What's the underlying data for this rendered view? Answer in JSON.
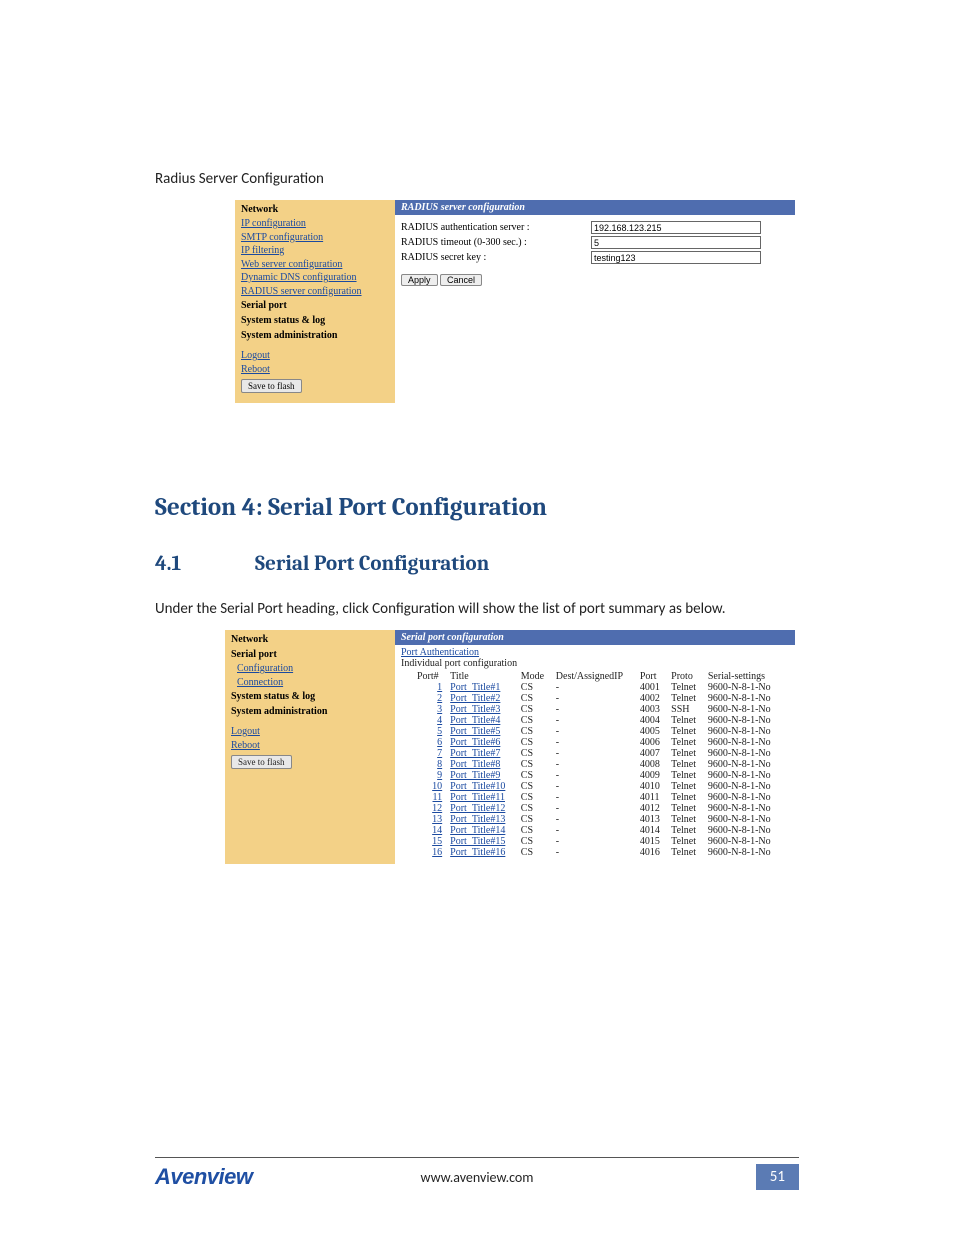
{
  "captions": {
    "radius": "Radius Server Configuration",
    "under_text": "Under the Serial Port heading, click Configuration will show the list of port summary as below."
  },
  "headings": {
    "section4": "Section 4: Serial Port Configuration",
    "h2_num": "4.1",
    "h2_title": "Serial Port Configuration"
  },
  "shot1": {
    "titlebar": "RADIUS server configuration",
    "nav": {
      "network_hdr": "Network",
      "links": {
        "ip": "IP configuration",
        "smtp": "SMTP configuration",
        "ipfilter": "IP filtering",
        "webserver": "Web server configuration",
        "ddns": "Dynamic DNS configuration",
        "radius": "RADIUS server configuration"
      },
      "serial_hdr": "Serial port",
      "status_hdr": "System status & log",
      "admin_hdr": "System administration",
      "logout": "Logout",
      "reboot": "Reboot",
      "saveflash": "Save to flash"
    },
    "form": {
      "auth_label": "RADIUS authentication server :",
      "auth_value": "192.168.123.215",
      "timeout_label": "RADIUS timeout (0-300 sec.) :",
      "timeout_value": "5",
      "secret_label": "RADIUS secret key :",
      "secret_value": "testing123",
      "apply": "Apply",
      "cancel": "Cancel"
    }
  },
  "shot2": {
    "titlebar": "Serial port configuration",
    "nav": {
      "network_hdr": "Network",
      "serial_hdr": "Serial port",
      "configuration": "Configuration",
      "connection": "Connection",
      "status_hdr": "System status & log",
      "admin_hdr": "System administration",
      "logout": "Logout",
      "reboot": "Reboot",
      "saveflash": "Save to flash"
    },
    "port_auth_link": "Port Authentication",
    "individual_label": "Individual port configuration",
    "columns": {
      "port": "Port#",
      "title": "Title",
      "mode": "Mode",
      "dest": "Dest/AssignedIP",
      "portnum": "Port",
      "proto": "Proto",
      "serial": "Serial-settings"
    },
    "rows": [
      {
        "n": "1",
        "title": "Port_Title#1",
        "mode": "CS",
        "dest": "-",
        "port": "4001",
        "proto": "Telnet",
        "serial": "9600-N-8-1-No"
      },
      {
        "n": "2",
        "title": "Port_Title#2",
        "mode": "CS",
        "dest": "-",
        "port": "4002",
        "proto": "Telnet",
        "serial": "9600-N-8-1-No"
      },
      {
        "n": "3",
        "title": "Port_Title#3",
        "mode": "CS",
        "dest": "-",
        "port": "4003",
        "proto": "SSH",
        "serial": "9600-N-8-1-No"
      },
      {
        "n": "4",
        "title": "Port_Title#4",
        "mode": "CS",
        "dest": "-",
        "port": "4004",
        "proto": "Telnet",
        "serial": "9600-N-8-1-No"
      },
      {
        "n": "5",
        "title": "Port_Title#5",
        "mode": "CS",
        "dest": "-",
        "port": "4005",
        "proto": "Telnet",
        "serial": "9600-N-8-1-No"
      },
      {
        "n": "6",
        "title": "Port_Title#6",
        "mode": "CS",
        "dest": "-",
        "port": "4006",
        "proto": "Telnet",
        "serial": "9600-N-8-1-No"
      },
      {
        "n": "7",
        "title": "Port_Title#7",
        "mode": "CS",
        "dest": "-",
        "port": "4007",
        "proto": "Telnet",
        "serial": "9600-N-8-1-No"
      },
      {
        "n": "8",
        "title": "Port_Title#8",
        "mode": "CS",
        "dest": "-",
        "port": "4008",
        "proto": "Telnet",
        "serial": "9600-N-8-1-No"
      },
      {
        "n": "9",
        "title": "Port_Title#9",
        "mode": "CS",
        "dest": "-",
        "port": "4009",
        "proto": "Telnet",
        "serial": "9600-N-8-1-No"
      },
      {
        "n": "10",
        "title": "Port_Title#10",
        "mode": "CS",
        "dest": "-",
        "port": "4010",
        "proto": "Telnet",
        "serial": "9600-N-8-1-No"
      },
      {
        "n": "11",
        "title": "Port_Title#11",
        "mode": "CS",
        "dest": "-",
        "port": "4011",
        "proto": "Telnet",
        "serial": "9600-N-8-1-No"
      },
      {
        "n": "12",
        "title": "Port_Title#12",
        "mode": "CS",
        "dest": "-",
        "port": "4012",
        "proto": "Telnet",
        "serial": "9600-N-8-1-No"
      },
      {
        "n": "13",
        "title": "Port_Title#13",
        "mode": "CS",
        "dest": "-",
        "port": "4013",
        "proto": "Telnet",
        "serial": "9600-N-8-1-No"
      },
      {
        "n": "14",
        "title": "Port_Title#14",
        "mode": "CS",
        "dest": "-",
        "port": "4014",
        "proto": "Telnet",
        "serial": "9600-N-8-1-No"
      },
      {
        "n": "15",
        "title": "Port_Title#15",
        "mode": "CS",
        "dest": "-",
        "port": "4015",
        "proto": "Telnet",
        "serial": "9600-N-8-1-No"
      },
      {
        "n": "16",
        "title": "Port_Title#16",
        "mode": "CS",
        "dest": "-",
        "port": "4016",
        "proto": "Telnet",
        "serial": "9600-N-8-1-No"
      }
    ]
  },
  "footer": {
    "brand": "Avenview",
    "url": "www.avenview.com",
    "page": "51"
  }
}
